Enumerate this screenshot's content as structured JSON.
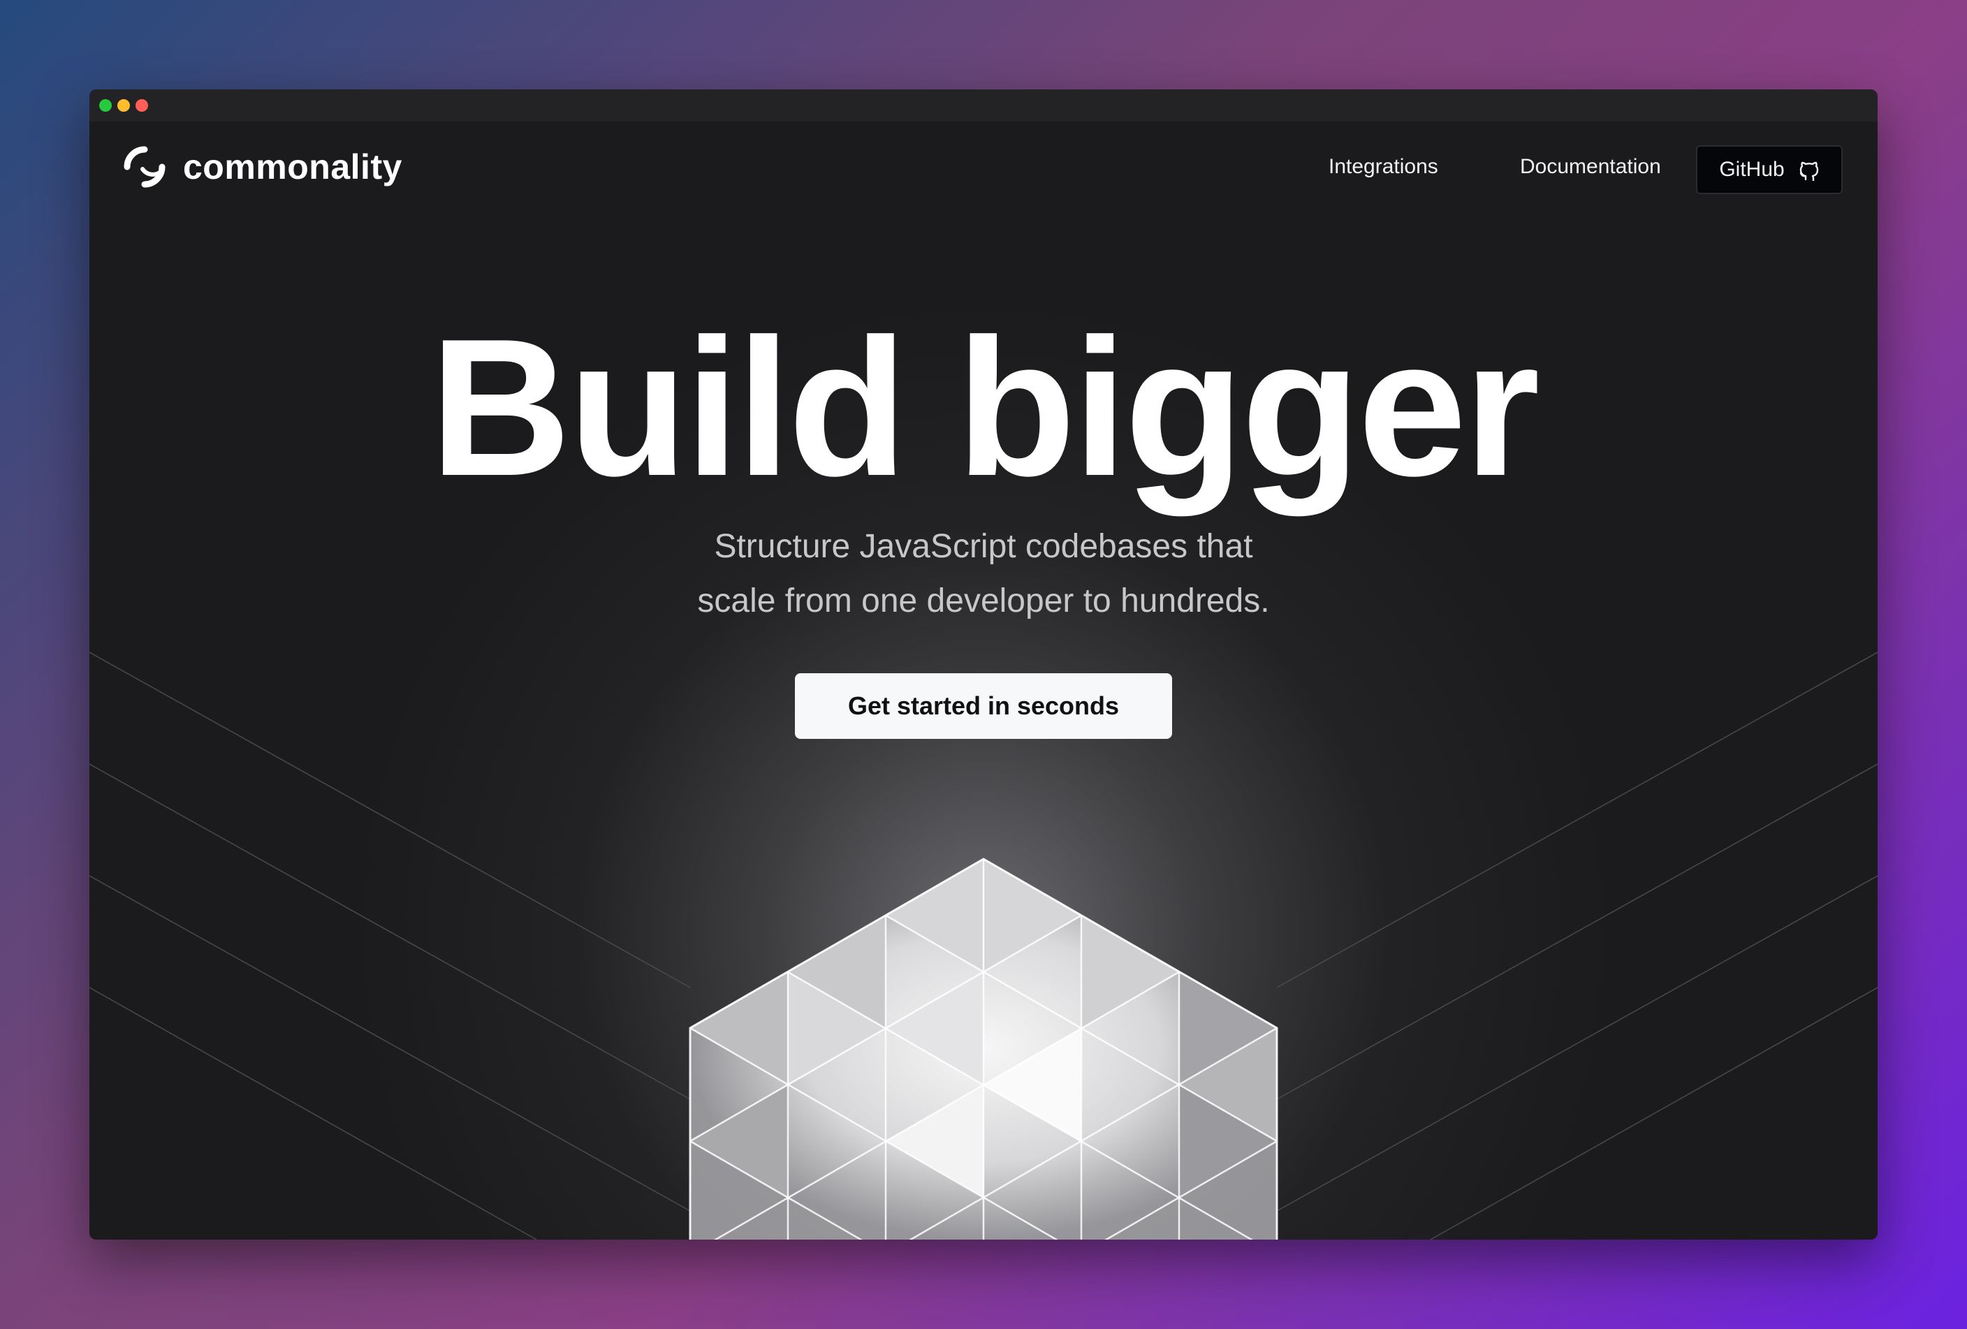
{
  "window": {
    "controls": [
      "close",
      "minimize",
      "maximize"
    ],
    "colors": {
      "close": "#ff5f56",
      "minimize": "#ffbd2e",
      "maximize": "#27c93f"
    }
  },
  "header": {
    "brand": "commonality",
    "logo_icon": "commonality-logo-icon",
    "nav": {
      "integrations": "Integrations",
      "documentation": "Documentation",
      "github": "GitHub",
      "github_icon": "github-icon"
    }
  },
  "hero": {
    "title": "Build bigger",
    "subtitle_line1": "Structure JavaScript codebases that",
    "subtitle_line2": "scale from one developer to hundreds.",
    "cta": "Get started in seconds"
  },
  "colors": {
    "background": "#1b1b1d",
    "cta_bg": "#f7f8fa",
    "github_bg": "#05060a"
  }
}
